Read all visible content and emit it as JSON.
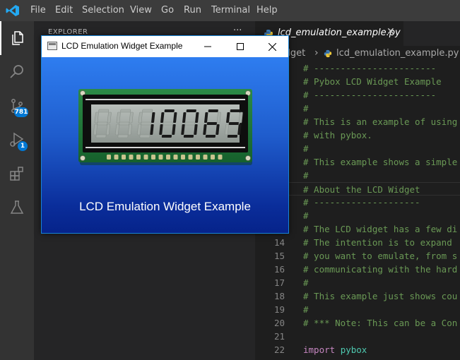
{
  "menubar": {
    "logo_icon": "vscode-logo-icon",
    "items": [
      "File",
      "Edit",
      "Selection",
      "View",
      "Go",
      "Run",
      "Terminal",
      "Help"
    ]
  },
  "activity_bar": {
    "explorer_icon": "files-icon",
    "search_icon": "search-icon",
    "scm_icon": "source-control-icon",
    "scm_badge": "781",
    "debug_icon": "run-debug-icon",
    "debug_badge": "1",
    "extensions_icon": "extensions-icon",
    "testing_icon": "flask-icon"
  },
  "sidebar": {
    "title": "EXPLORER",
    "more": "···"
  },
  "tab": {
    "label": "lcd_emulation_example.py",
    "close": "✕",
    "icon": "python-icon"
  },
  "breadcrumb": {
    "folder": "idget",
    "file": "lcd_emulation_example.py"
  },
  "editor": {
    "lines": [
      {
        "n": "",
        "text": "# -----------------------"
      },
      {
        "n": "",
        "text": "# Pybox LCD Widget Example"
      },
      {
        "n": "",
        "text": "# -----------------------"
      },
      {
        "n": "",
        "text": "#"
      },
      {
        "n": "",
        "text": "# This is an example of using"
      },
      {
        "n": "",
        "text": "# with pybox."
      },
      {
        "n": "",
        "text": "#"
      },
      {
        "n": "",
        "text": "# This example shows a simple"
      },
      {
        "n": "",
        "text": "#"
      },
      {
        "n": "",
        "text": "# About the LCD Widget"
      },
      {
        "n": "",
        "text": "# --------------------"
      },
      {
        "n": "",
        "text": "#"
      },
      {
        "n": "",
        "text": "# The LCD widget has a few di"
      },
      {
        "n": "14",
        "text": "# The intention is to expand"
      },
      {
        "n": "15",
        "text": "# you want to emulate, from s"
      },
      {
        "n": "16",
        "text": "# communicating with the hard"
      },
      {
        "n": "17",
        "text": "#"
      },
      {
        "n": "18",
        "text": "# This example just shows cou"
      },
      {
        "n": "19",
        "text": "#"
      },
      {
        "n": "20",
        "text": "# *** Note: This can be a Con"
      },
      {
        "n": "21",
        "text": ""
      },
      {
        "n": "22",
        "kw": "import",
        "mod": "pybox"
      }
    ]
  },
  "dialog": {
    "title": "LCD Emulation Widget Example",
    "minimize_icon": "minimize-icon",
    "maximize_icon": "maximize-icon",
    "close_icon": "close-icon",
    "lcd_value": "10065",
    "caption": "LCD Emulation Widget Example",
    "colors": {
      "gradient_top": "#2e7df0",
      "gradient_bottom": "#06238a",
      "pcb": "#1f7a3a"
    }
  }
}
